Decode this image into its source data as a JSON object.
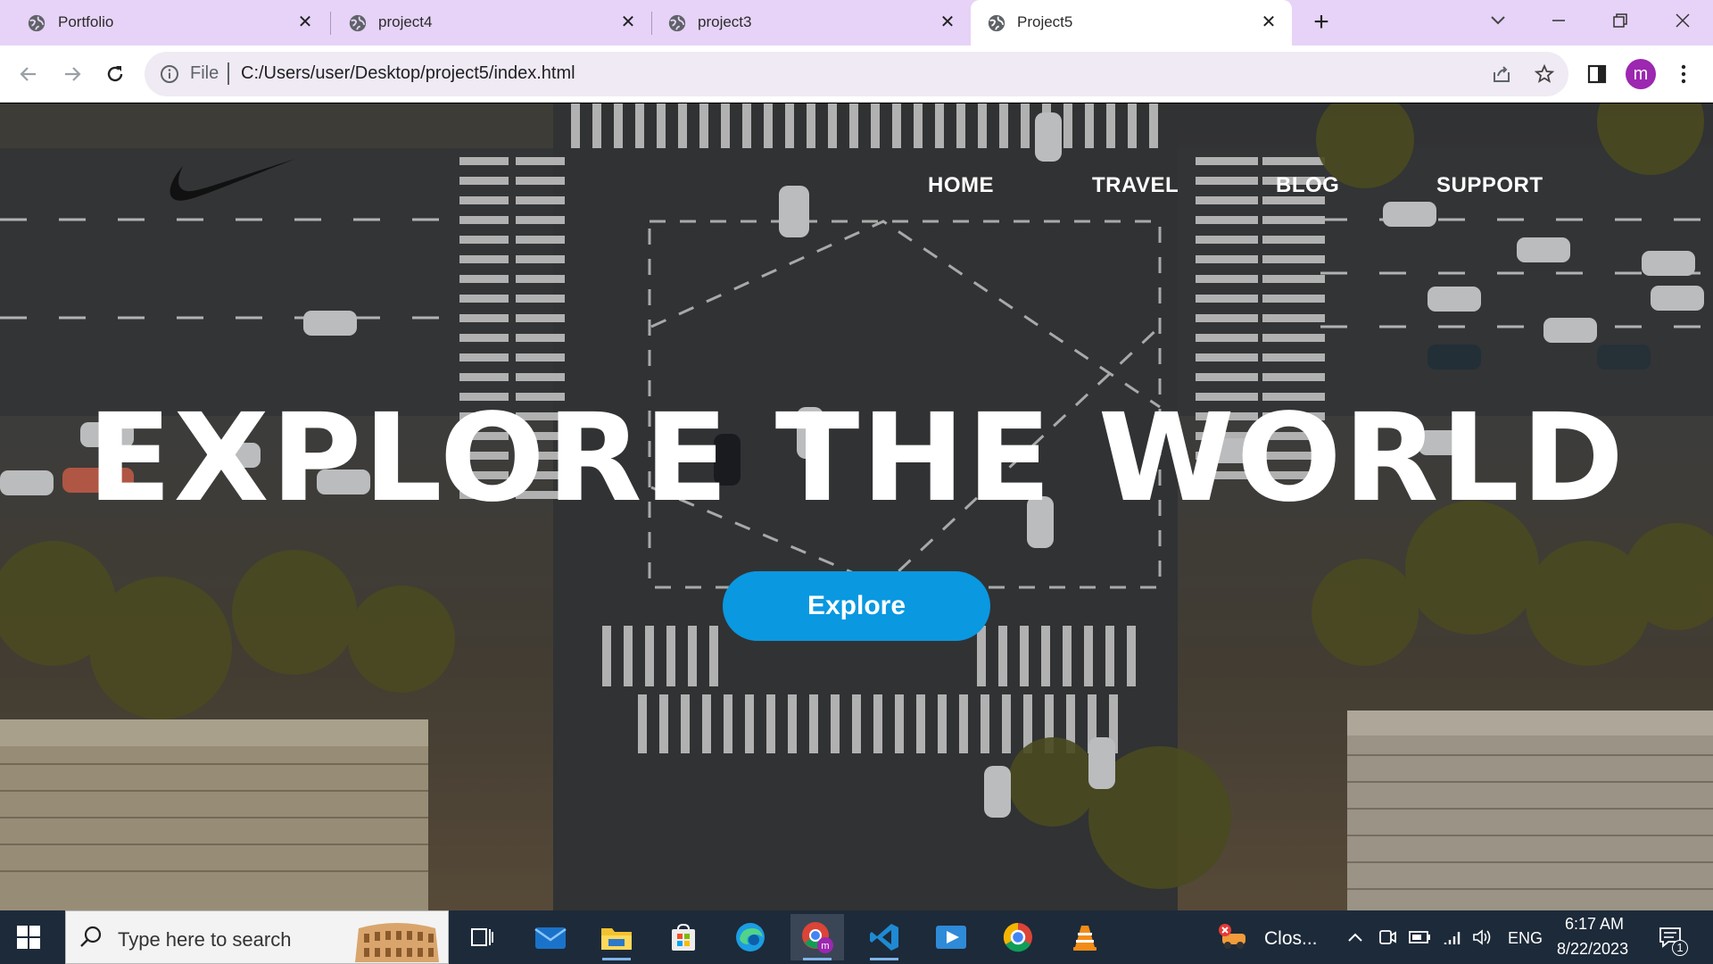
{
  "browser": {
    "tabs": [
      {
        "title": "Portfolio",
        "active": false
      },
      {
        "title": "project4",
        "active": false
      },
      {
        "title": "project3",
        "active": false
      },
      {
        "title": "Project5",
        "active": true
      }
    ],
    "address": {
      "scheme_label": "File",
      "url": "C:/Users/user/Desktop/project5/index.html"
    },
    "profile_initial": "m",
    "colors": {
      "tabstrip": "#e6d3f7",
      "omnibox": "#efeaf3",
      "avatar": "#9c27b0"
    }
  },
  "page": {
    "logo": "nike-swoosh-logo",
    "nav": [
      "HOME",
      "TRAVEL",
      "BLOG",
      "SUPPORT"
    ],
    "headline": "EXPLORE THE WORLD",
    "cta_label": "Explore",
    "colors": {
      "cta": "#0a98e0",
      "text": "#ffffff"
    }
  },
  "taskbar": {
    "search_placeholder": "Type here to search",
    "apps": [
      "task-view-icon",
      "mail-icon",
      "file-explorer-icon",
      "microsoft-store-icon",
      "edge-icon",
      "chrome-profile-icon",
      "vscode-icon",
      "media-player-icon",
      "chrome-icon",
      "vlc-icon"
    ],
    "notification_label": "Clos...",
    "language": "ENG",
    "time": "6:17 AM",
    "date": "8/22/2023",
    "notification_count": "1"
  }
}
